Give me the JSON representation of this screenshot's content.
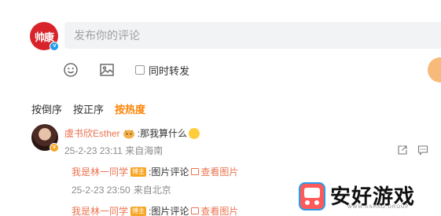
{
  "composer": {
    "avatar_text": "帅康",
    "avatar_badge": "v",
    "placeholder": "发布你的评论",
    "repost_label": "同时转发"
  },
  "sort_tabs": [
    {
      "label": "按倒序",
      "active": false
    },
    {
      "label": "按正序",
      "active": false
    },
    {
      "label": "按热度",
      "active": true
    }
  ],
  "comment": {
    "user": "虞书欣Esther",
    "text": ":那我算什么",
    "timestamp": "25-2-23 23:11",
    "location": "来自海南",
    "avatar_badge": "v",
    "replies": [
      {
        "user": "我是林一同学",
        "level": "博主",
        "text": ":图片评论",
        "view_label": "查看图片",
        "timestamp": "25-2-23 23:50",
        "location": "来自北京"
      },
      {
        "user": "我是林一同学",
        "level": "博主",
        "text": ":图片评论",
        "view_label": "查看图片"
      }
    ]
  },
  "watermark": {
    "text": "安好游戏",
    "subtext": "WWW.ANHAO.GROUP"
  },
  "colors": {
    "accent": "#ff8200",
    "link": "#eb7350",
    "brand_red": "#d9232b",
    "send_button": "#f8ba7b"
  }
}
